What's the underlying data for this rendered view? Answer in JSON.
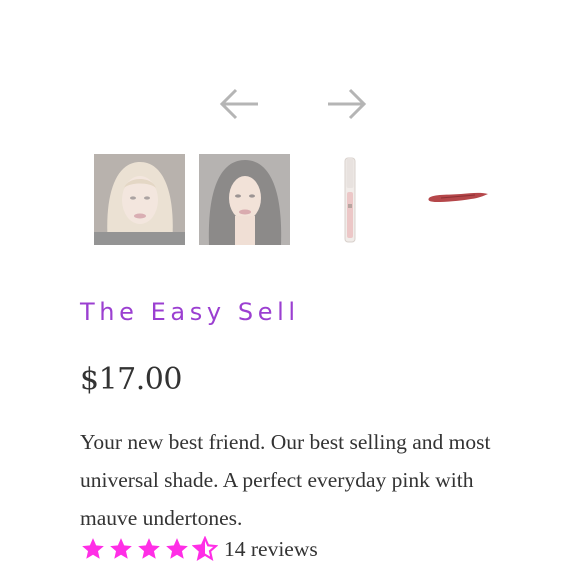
{
  "gallery": {
    "prev_icon": "arrow-left-icon",
    "next_icon": "arrow-right-icon",
    "thumbnails": [
      {
        "kind": "model-photo-blonde"
      },
      {
        "kind": "model-photo-brunette"
      },
      {
        "kind": "lip-gloss-tube"
      },
      {
        "kind": "lip-swatch"
      }
    ]
  },
  "product": {
    "title": "The Easy Sell",
    "price": "$17.00",
    "description": "Your new best friend. Our best selling and most universal shade. A perfect everyday pink with mauve undertones.",
    "rating": 4.5,
    "reviews_label": "14 reviews"
  },
  "colors": {
    "accent": "#9b3fd1",
    "star": "#ff2ee6",
    "text": "#333333",
    "arrow": "#b5b5b5",
    "swatch": "#b5474a"
  }
}
